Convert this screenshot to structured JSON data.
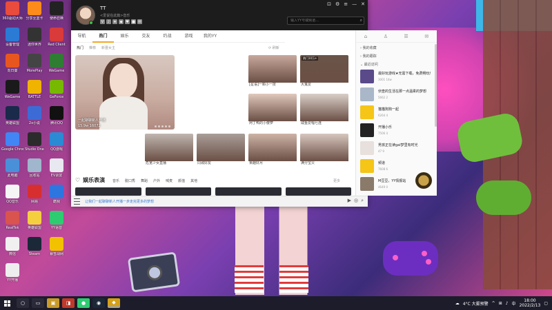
{
  "desktop": {
    "icons": [
      {
        "label": "360驱动大师",
        "color": "#e94b3c"
      },
      {
        "label": "分享至蓝卡",
        "color": "#ff8c1a"
      },
      {
        "label": "使命召唤",
        "color": "#222222"
      },
      {
        "label": "设备管理",
        "color": "#2b7bd5"
      },
      {
        "label": "迷你世界",
        "color": "#333333"
      },
      {
        "label": "Red Client",
        "color": "#d93a3a"
      },
      {
        "label": "向日葵",
        "color": "#e8561f"
      },
      {
        "label": "MorePlay",
        "color": "#444444"
      },
      {
        "label": "WeGame",
        "color": "#2e7d32"
      },
      {
        "label": "WeGame",
        "color": "#1a1a1a"
      },
      {
        "label": "BATTLE",
        "color": "#f0b400"
      },
      {
        "label": "GeForce",
        "color": "#76b900"
      },
      {
        "label": "英雄联盟",
        "color": "#1a2a4a"
      },
      {
        "label": "2x小说",
        "color": "#3d6bd6"
      },
      {
        "label": "腾讯QQ",
        "color": "#111111"
      },
      {
        "label": "Google Chrome",
        "color": "#4285f4"
      },
      {
        "label": "Studio One",
        "color": "#2b2b2b"
      },
      {
        "label": "QQ游戏",
        "color": "#2a8ad4"
      },
      {
        "label": "此电脑",
        "color": "#4a90d9"
      },
      {
        "label": "回收站",
        "color": "#9fb6cc"
      },
      {
        "label": "EV录屏",
        "color": "#e8e8f0"
      },
      {
        "label": "QQ音乐",
        "color": "#f5f5f5"
      },
      {
        "label": "网易",
        "color": "#d72f2f"
      },
      {
        "label": "酷我",
        "color": "#2d76e0"
      },
      {
        "label": "RealTek",
        "color": "#d9534f"
      },
      {
        "label": "英雄联盟",
        "color": "#f4d03f"
      },
      {
        "label": "YY语音",
        "color": "#2ecc71"
      },
      {
        "label": "微信",
        "color": "#f0f0f0"
      },
      {
        "label": "Steam",
        "color": "#1b2838"
      },
      {
        "label": "暴雪战网",
        "color": "#f2c200"
      },
      {
        "label": "YY开播",
        "color": "#eeeeee"
      }
    ]
  },
  "taskbar": {
    "apps": [
      {
        "icon": "search-icon",
        "glyph": "○"
      },
      {
        "icon": "task-view-icon",
        "glyph": "▭"
      },
      {
        "icon": "explorer-icon",
        "glyph": "▣"
      },
      {
        "icon": "photo-app-icon",
        "glyph": "◨"
      },
      {
        "icon": "app-green-icon",
        "glyph": "●"
      },
      {
        "icon": "steam-icon",
        "glyph": "◉"
      },
      {
        "icon": "yy-icon",
        "glyph": "◆"
      }
    ],
    "weather": "4°C 大雾预警",
    "time": "18:00",
    "date": "2022/2/13"
  },
  "app": {
    "user": {
      "name": "TT",
      "signature": "<爱说在此篇>音乐"
    },
    "search_placeholder": "输入YY号或频道...",
    "tabs": [
      "导航",
      "热门",
      "娱乐",
      "交友",
      "约战",
      "游戏",
      "我的YY"
    ],
    "active_tab": "热门",
    "subtabs": [
      "热门",
      "推荐",
      "新晋女主"
    ],
    "refresh": "刷新",
    "hero": {
      "caption": "一起聊聊新人开播",
      "count": "15.9w 16072"
    },
    "tiles": [
      {
        "tag": "",
        "caption": "[星语]一颗小一技"
      },
      {
        "tag": "热门10万+",
        "caption": "大鬼爱"
      },
      {
        "tag": "",
        "caption": "阿丁鸭的小傻萝"
      },
      {
        "tag": "",
        "caption": "咸鱼爱唱七连"
      },
      {
        "tag": "",
        "caption": "危宽少女直播"
      },
      {
        "tag": "",
        "caption": "同城好友"
      },
      {
        "tag": "",
        "caption": "果趣好月"
      },
      {
        "tag": "",
        "caption": "满分宝贝"
      }
    ],
    "section": {
      "title": "娱乐表演",
      "cats": [
        "音乐",
        "脱口秀",
        "舞蹈",
        "户外",
        "喊麦",
        "颜值",
        "其他"
      ],
      "more": "更多"
    },
    "notice": "让我们一起聊聊新人开播一步走完更多的梦想",
    "side": {
      "sec_collect": "我的收藏",
      "sec_track": "我的跟踪",
      "sec_recent": "最近访问",
      "items": [
        {
          "name": "最好玩游戏★无需下载，免费畅玩!",
          "meta": "3001 14w",
          "color": "#5a4a8a"
        },
        {
          "name": "侦查的生活在那一点温柔的梦想",
          "meta": "5662 2",
          "color": "#a9b7c9"
        },
        {
          "name": "猫猫狗狗一起",
          "meta": "6264 4",
          "color": "#f5c518"
        },
        {
          "name": "开播小乐",
          "meta": "7506 4",
          "color": "#222222"
        },
        {
          "name": "男孩正在读gal梦里有时光",
          "meta": "47 9",
          "color": "#e8e0dc"
        },
        {
          "name": "频道",
          "meta": "7608 6",
          "color": "#f5c518"
        },
        {
          "name": "M豆豆，YY情报站",
          "meta": "4649 0",
          "color": "#8a7a6a"
        }
      ]
    }
  },
  "colors": {
    "accent": "#f5a623",
    "link": "#3a7bd5",
    "header": "#1c1c1c"
  }
}
